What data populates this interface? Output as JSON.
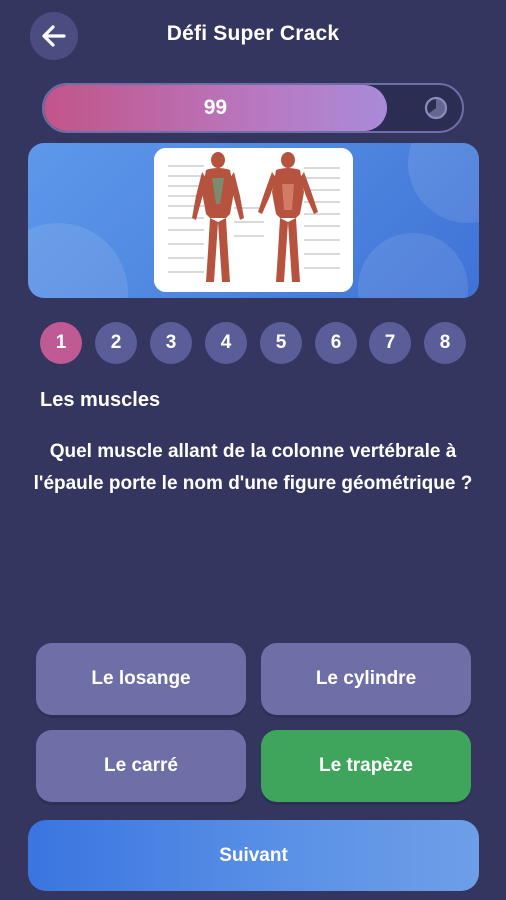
{
  "header": {
    "title": "Défi Super Crack",
    "back_icon": "arrow-left-icon"
  },
  "progress": {
    "value": "99",
    "fill_percent": 82,
    "timer_icon": "timer-icon"
  },
  "image": {
    "description_icon": "muscle-anatomy-image"
  },
  "steps": [
    "1",
    "2",
    "3",
    "4",
    "5",
    "6",
    "7",
    "8"
  ],
  "active_step": 1,
  "quiz": {
    "category": "Les muscles",
    "question": "Quel muscle allant de la colonne vertébrale à l'épaule porte le nom d'une figure géométrique ?",
    "answers": [
      "Le losange",
      "Le cylindre",
      "Le carré",
      "Le trapèze"
    ],
    "correct_index": 3
  },
  "next_label": "Suivant",
  "colors": {
    "background": "#353660",
    "answer": "#6e6fa6",
    "correct": "#3fa55c",
    "active_step": "#c05a95"
  }
}
